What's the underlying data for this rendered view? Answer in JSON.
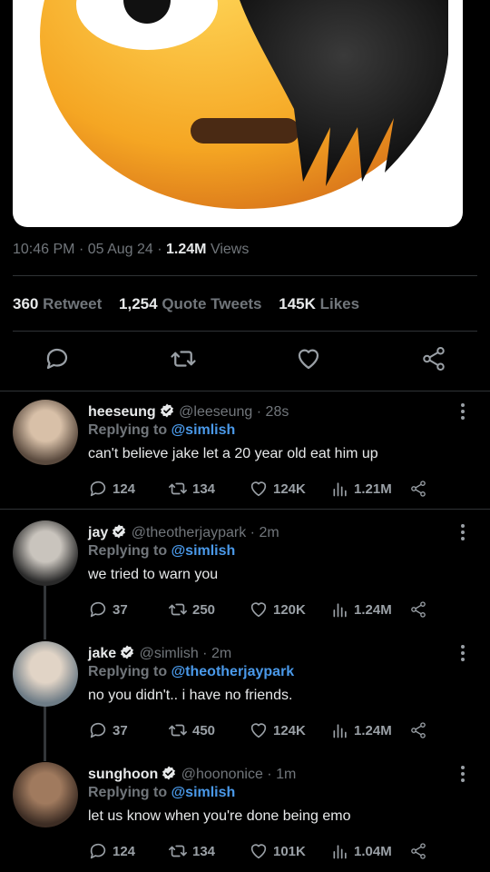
{
  "tweet": {
    "time": "10:46 PM",
    "date": "05 Aug 24",
    "views_count": "1.24M",
    "views_label": "Views",
    "retweets_count": "360",
    "retweets_label": "Retweet",
    "quotes_count": "1,254",
    "quotes_label": "Quote Tweets",
    "likes_count": "145K",
    "likes_label": "Likes"
  },
  "actions": [
    "reply-icon",
    "retweet-icon",
    "heart-icon",
    "share-icon"
  ],
  "replies": [
    {
      "name": "heeseung",
      "handle": "@leeseung",
      "time": "28s",
      "replying_prefix": "Replying to",
      "replying_to": "@simlish",
      "text": "can't believe jake let a 20 year old eat him up",
      "replies": "124",
      "retweets": "134",
      "likes": "124K",
      "views": "1.21M"
    },
    {
      "name": "jay",
      "handle": "@theotherjaypark",
      "time": "2m",
      "replying_prefix": "Replying to",
      "replying_to": "@simlish",
      "text": "we tried to warn you",
      "replies": "37",
      "retweets": "250",
      "likes": "120K",
      "views": "1.24M"
    },
    {
      "name": "jake",
      "handle": "@simlish",
      "time": "2m",
      "replying_prefix": "Replying to",
      "replying_to": "@theotherjaypark",
      "text": "no you didn't.. i have no friends.",
      "replies": "37",
      "retweets": "450",
      "likes": "124K",
      "views": "1.24M"
    },
    {
      "name": "sunghoon",
      "handle": "@hoononice",
      "time": "1m",
      "replying_prefix": "Replying to",
      "replying_to": "@simlish",
      "text": "let us know when you're done being emo",
      "replies": "124",
      "retweets": "134",
      "likes": "101K",
      "views": "1.04M"
    }
  ],
  "colors": {
    "link": "#4a99e9",
    "muted": "#71767b",
    "background": "#000000"
  }
}
